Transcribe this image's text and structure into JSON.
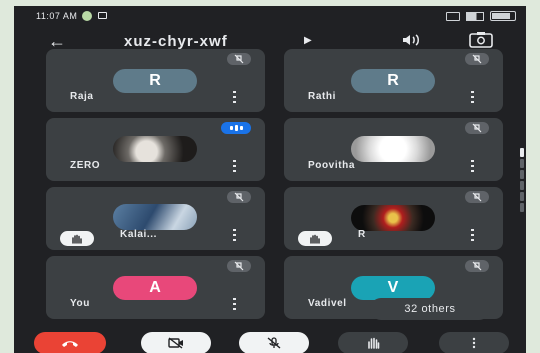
{
  "status_bar": {
    "time": "11:07 AM"
  },
  "header": {
    "meeting_code": "xuz-chyr-xwf"
  },
  "participants": [
    {
      "name": "Raja",
      "avatar_letter": "R",
      "avatar_color": "#5f7b8a",
      "mic": "off"
    },
    {
      "name": "Rathi",
      "avatar_letter": "R",
      "avatar_color": "#5f7b8a",
      "mic": "off"
    },
    {
      "name": "ZERO",
      "avatar": "photo",
      "mic": "speaking"
    },
    {
      "name": "Poovitha",
      "avatar": "photo",
      "mic": "off"
    },
    {
      "name": "Kalai...",
      "avatar": "photo",
      "mic": "off",
      "hand_raised": true
    },
    {
      "name": "R",
      "avatar": "photo",
      "mic": "off",
      "hand_raised": true
    },
    {
      "name": "You",
      "avatar_letter": "A",
      "avatar_color": "#e8487a",
      "mic": "off"
    },
    {
      "name": "Vadivel",
      "avatar_letter": "V",
      "avatar_color": "#1aa3b5",
      "mic": "off"
    }
  ],
  "others_count_label": "32 others",
  "controls": {
    "end_call_color": "#ea4335"
  }
}
